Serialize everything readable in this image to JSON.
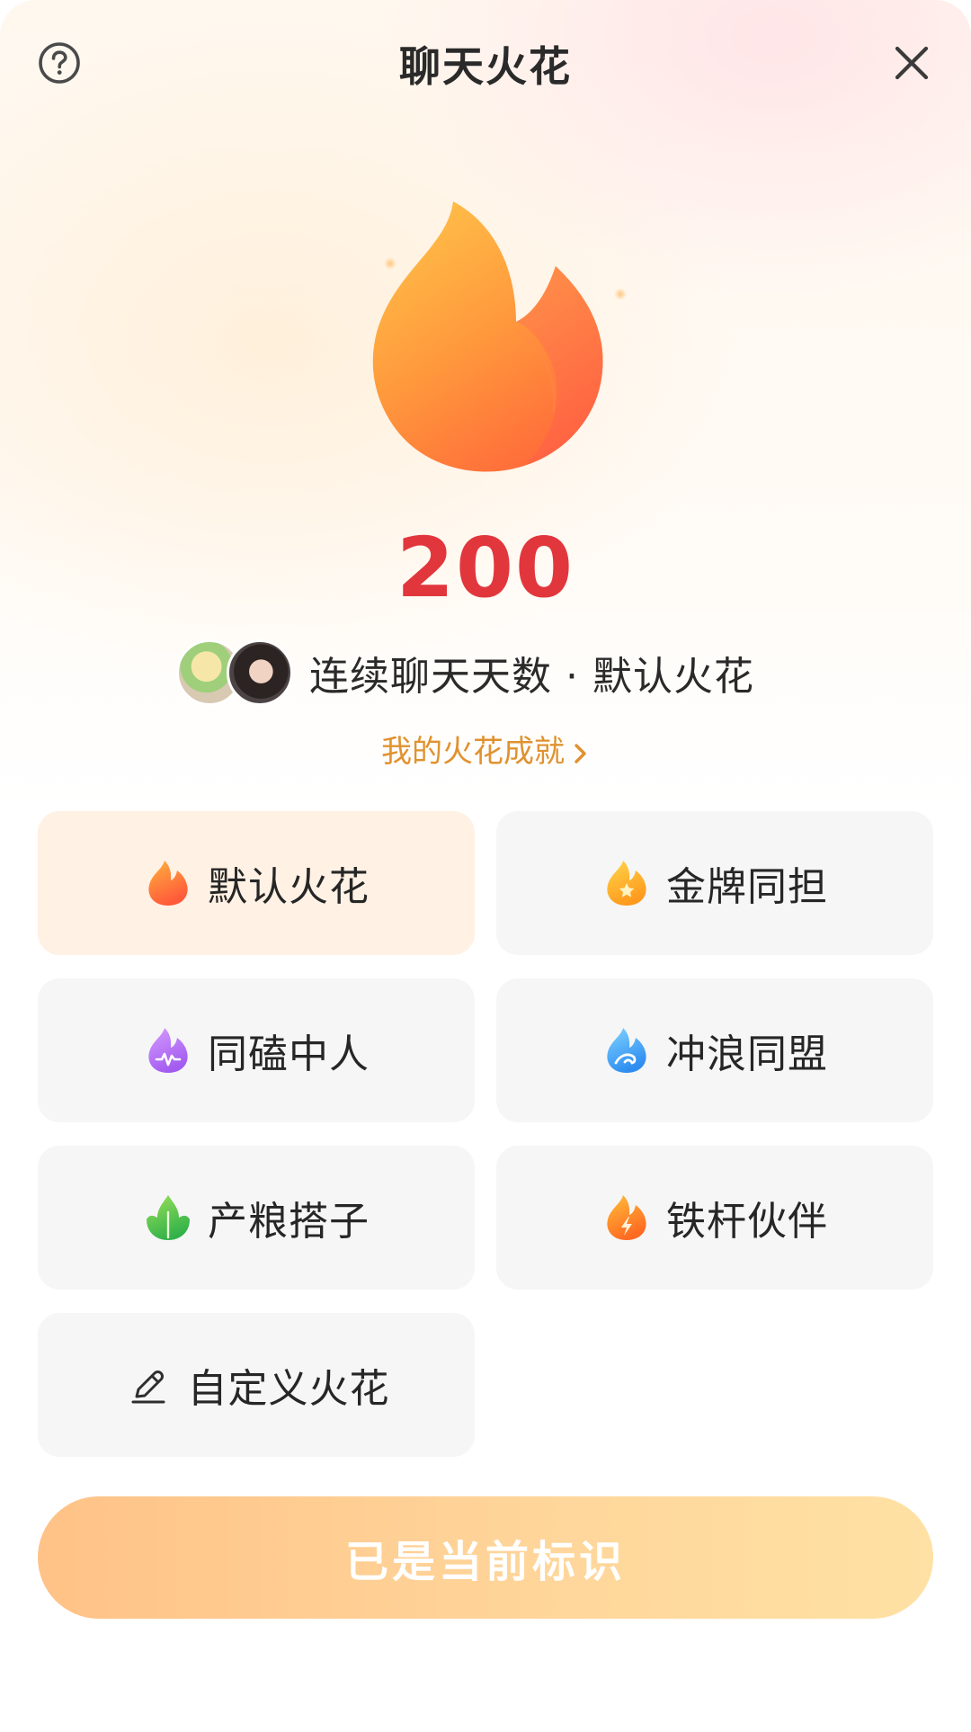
{
  "header": {
    "title": "聊天火花",
    "help_icon": "question-circle-icon",
    "close_icon": "close-icon"
  },
  "hero": {
    "streak_count": "200",
    "subtitle": "连续聊天天数 · 默认火花",
    "achievement_link": "我的火花成就",
    "flame_colors": [
      "#ffc240",
      "#ff7a3c",
      "#ff5a3a"
    ]
  },
  "options": [
    {
      "label": "默认火花",
      "icon": "orange-flame-icon",
      "selected": true
    },
    {
      "label": "金牌同担",
      "icon": "gold-star-flame-icon",
      "selected": false
    },
    {
      "label": "同磕中人",
      "icon": "purple-pulse-flame-icon",
      "selected": false
    },
    {
      "label": "冲浪同盟",
      "icon": "blue-wave-flame-icon",
      "selected": false
    },
    {
      "label": "产粮搭子",
      "icon": "green-leaf-flame-icon",
      "selected": false
    },
    {
      "label": "铁杆伙伴",
      "icon": "orange-bolt-flame-icon",
      "selected": false
    },
    {
      "label": "自定义火花",
      "icon": "pencil-icon",
      "selected": false
    }
  ],
  "cta": {
    "label": "已是当前标识"
  },
  "colors": {
    "accent_red": "#e2363d",
    "link_orange": "#e0922f",
    "selected_bg": "#fff1e3",
    "card_bg": "#f6f6f7"
  }
}
